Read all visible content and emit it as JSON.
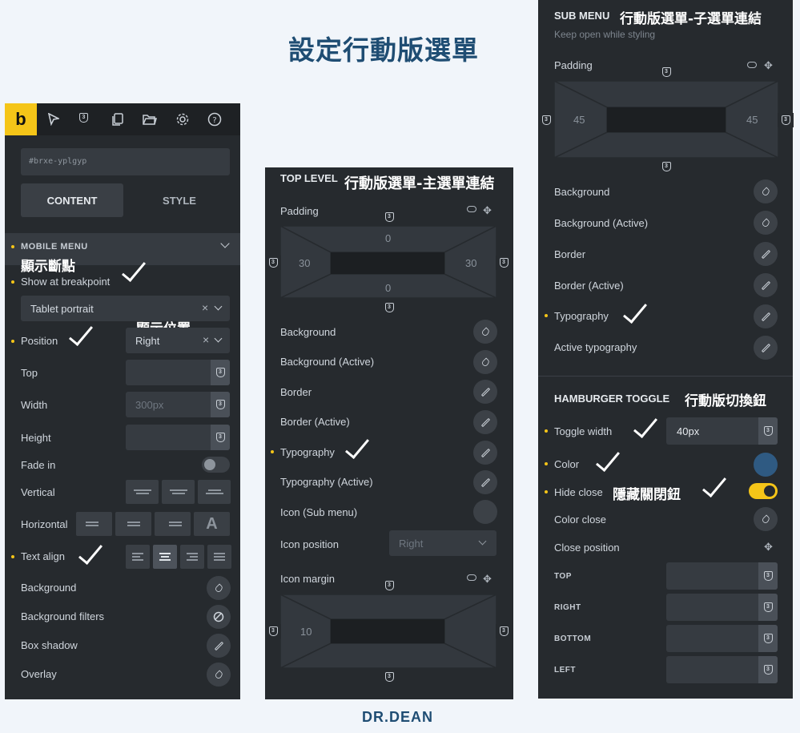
{
  "page_title": "設定行動版選單",
  "footer_logo": "DR.DEAN",
  "panel_left": {
    "element_id": "#brxe-yplgyp",
    "tabs": [
      "CONTENT",
      "STYLE"
    ],
    "section": "MOBILE MENU",
    "annotation_breakpoint": "顯示斷點",
    "annotation_position": "顯示位置",
    "show_at_breakpoint_label": "Show at breakpoint",
    "breakpoint_value": "Tablet portrait",
    "position_label": "Position",
    "position_value": "Right",
    "top_label": "Top",
    "width_label": "Width",
    "width_placeholder": "300px",
    "height_label": "Height",
    "fade_in_label": "Fade in",
    "vertical_label": "Vertical",
    "horizontal_label": "Horizontal",
    "text_align_label": "Text align",
    "background_label": "Background",
    "background_filters_label": "Background filters",
    "box_shadow_label": "Box shadow",
    "overlay_label": "Overlay",
    "logo_letter": "b",
    "colors": {
      "accent": "#f5c518",
      "panel": "#262a2e"
    }
  },
  "panel_middle": {
    "header_en": "TOP LEVEL",
    "header_zh": "行動版選單-主選單連結",
    "padding_label": "Padding",
    "padding": {
      "top": "0",
      "right": "30",
      "bottom": "0",
      "left": "30"
    },
    "rows": [
      "Background",
      "Background (Active)",
      "Border",
      "Border (Active)",
      "Typography",
      "Typography (Active)",
      "Icon (Sub menu)"
    ],
    "icon_position_label": "Icon position",
    "icon_position_value": "Right",
    "icon_margin_label": "Icon margin",
    "icon_margin": {
      "left": "10"
    }
  },
  "panel_right": {
    "header_en": "SUB MENU",
    "header_zh": "行動版選單-子選單連結",
    "subtitle": "Keep open while styling",
    "padding_label": "Padding",
    "padding": {
      "left": "45",
      "right": "45"
    },
    "rows": [
      "Background",
      "Background (Active)",
      "Border",
      "Border (Active)",
      "Typography",
      "Active typography"
    ],
    "toggle_header_en": "HAMBURGER TOGGLE",
    "toggle_header_zh": "行動版切換鈕",
    "toggle_width_label": "Toggle width",
    "toggle_width_value": "40px",
    "color_label": "Color",
    "color_value": "#2f5a82",
    "hide_close_label": "Hide close",
    "hide_close_annotation": "隱藏關閉鈕",
    "color_close_label": "Color close",
    "close_position_label": "Close position",
    "sides": [
      "TOP",
      "RIGHT",
      "BOTTOM",
      "LEFT"
    ]
  }
}
